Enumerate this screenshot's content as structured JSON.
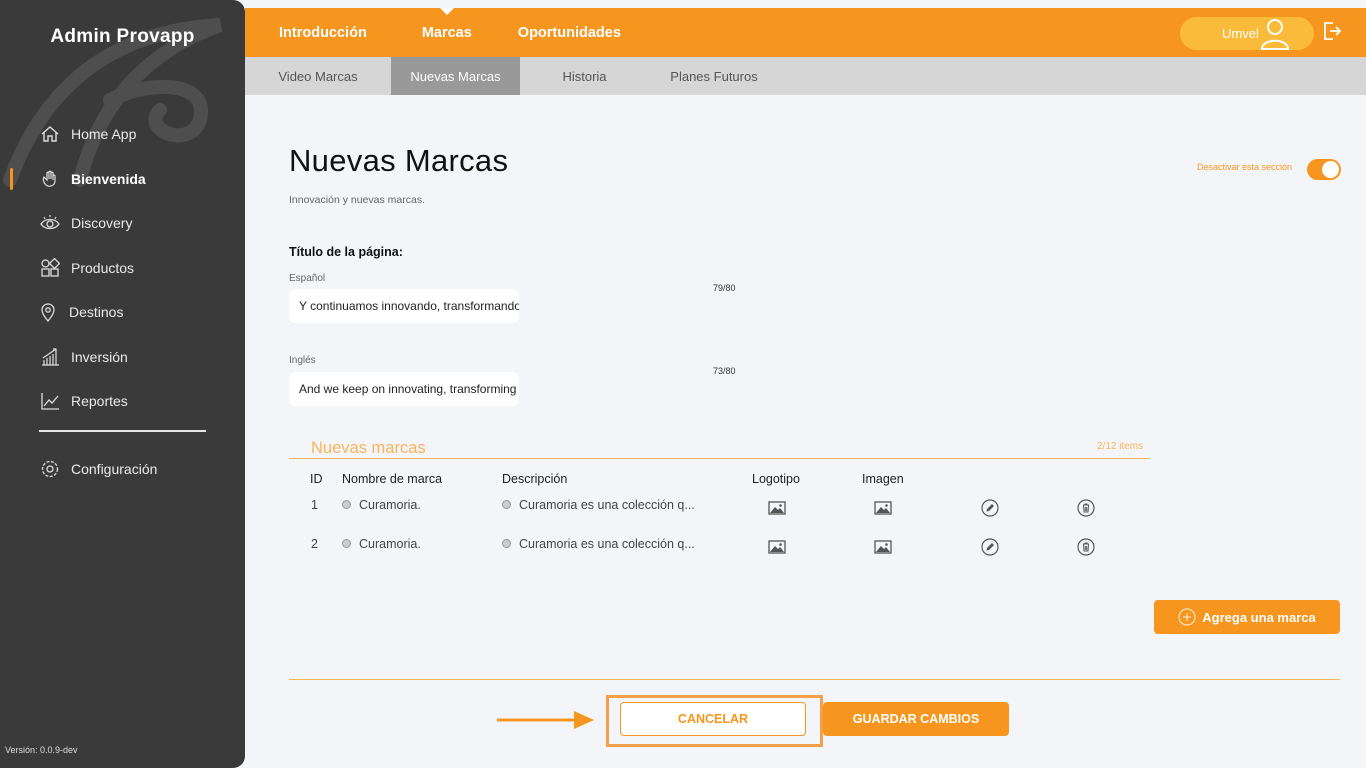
{
  "brand": "Admin Provapp",
  "version": "Versión: 0.0.9-dev",
  "sidebar": {
    "items": [
      {
        "label": "Home App",
        "icon": "home-icon"
      },
      {
        "label": "Bienvenida",
        "icon": "wave-hand-icon",
        "active": true
      },
      {
        "label": "Discovery",
        "icon": "eye-icon"
      },
      {
        "label": "Productos",
        "icon": "grid-shapes-icon"
      },
      {
        "label": "Destinos",
        "icon": "location-pin-icon"
      },
      {
        "label": "Inversión",
        "icon": "bar-growth-icon"
      },
      {
        "label": "Reportes",
        "icon": "line-chart-icon"
      }
    ],
    "config": {
      "label": "Configuración",
      "icon": "gear-icon"
    }
  },
  "topbar": {
    "tabs": [
      "Introducción",
      "Marcas",
      "Oportunidades"
    ],
    "active_tab": "Marcas",
    "user": "Umvel"
  },
  "subtabs": {
    "items": [
      "Video Marcas",
      "Nuevas Marcas",
      "Historia",
      "Planes Futuros"
    ],
    "active": "Nuevas Marcas"
  },
  "page": {
    "title": "Nuevas Marcas",
    "subtitle": "Innovación y nuevas marcas.",
    "toggle_label": "Desactivar esta sección",
    "toggle_on": true
  },
  "form": {
    "section_label": "Título de la página:",
    "spanish": {
      "label": "Español",
      "value": "Y continuamos innovando, transformando",
      "counter": "79/80"
    },
    "english": {
      "label": "Inglés",
      "value": "And we keep on innovating, transforming",
      "counter": "73/80"
    }
  },
  "list": {
    "title": "Nuevas marcas",
    "count": "2/12 items",
    "headers": {
      "id": "ID",
      "name": "Nombre de marca",
      "description": "Descripción",
      "logo": "Logotipo",
      "image": "Imagen"
    },
    "rows": [
      {
        "id": "1",
        "name": "Curamoria.",
        "description": "Curamoria es una colección q..."
      },
      {
        "id": "2",
        "name": "Curamoria.",
        "description": "Curamoria es una colección q..."
      }
    ]
  },
  "buttons": {
    "add": "Agrega una marca",
    "cancel": "CANCELAR",
    "save": "GUARDAR CAMBIOS"
  },
  "colors": {
    "accent": "#f7961f",
    "sidebar": "#3a3a3a",
    "background": "#f4f5f9"
  }
}
